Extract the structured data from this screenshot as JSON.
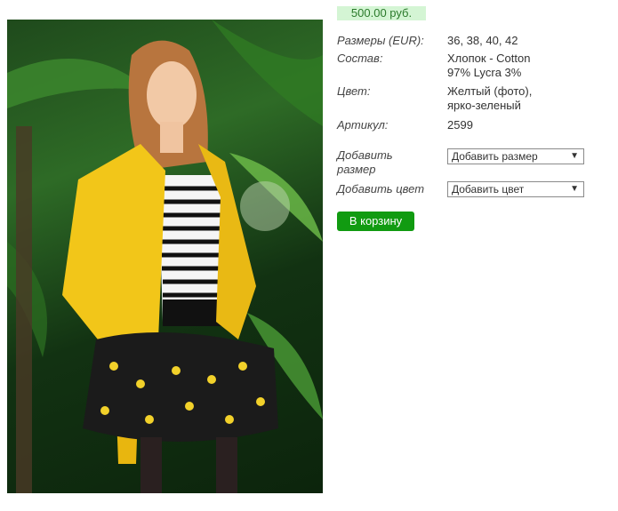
{
  "product": {
    "price": "500.00 руб.",
    "specs": [
      {
        "label": "Размеры (EUR):",
        "value": [
          "36, 38, 40, 42"
        ]
      },
      {
        "label": "Состав:",
        "value": [
          "Хлопок - Cotton",
          "97% Lycra 3%"
        ]
      },
      {
        "label": "Цвет:",
        "value": [
          "Желтый (фото),",
          "ярко-зеленый"
        ]
      },
      {
        "label": "Артикул:",
        "value": [
          "2599"
        ]
      }
    ],
    "add_size_label": [
      "Добавить",
      "размер"
    ],
    "add_size_select": "Добавить размер",
    "add_color_label": "Добавить цвет",
    "add_color_select": "Добавить цвет",
    "cart_button": "В корзину",
    "colors": {
      "price_bg": "#d4f5d4",
      "price_text": "#2a7a2a",
      "button": "#119b11"
    }
  }
}
